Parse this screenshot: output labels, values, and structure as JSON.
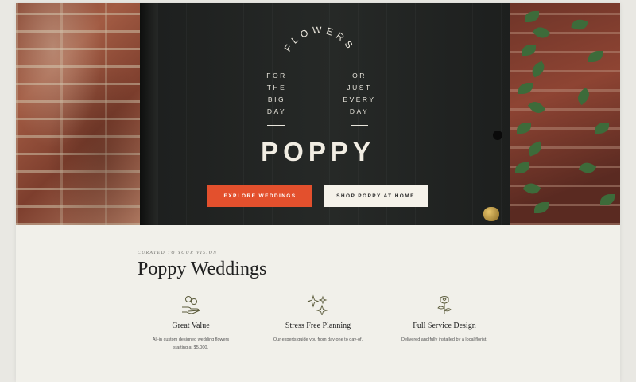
{
  "hero": {
    "arch_text": "FLOWERS",
    "tagline_left": [
      "FOR",
      "THE",
      "BIG",
      "DAY"
    ],
    "tagline_right": [
      "OR",
      "JUST",
      "EVERY",
      "DAY"
    ],
    "logo": "POPPY",
    "buttons": {
      "primary": "EXPLORE WEDDINGS",
      "secondary": "SHOP POPPY AT HOME"
    }
  },
  "weddings": {
    "eyebrow": "CURATED TO YOUR VISION",
    "title": "Poppy Weddings",
    "features": [
      {
        "icon": "hand-money-icon",
        "title": "Great Value",
        "desc": "All-in custom designed wedding flowers starting at $5,000."
      },
      {
        "icon": "sparkles-icon",
        "title": "Stress Free Planning",
        "desc": "Our experts guide you from day one to day-of."
      },
      {
        "icon": "rose-icon",
        "title": "Full Service Design",
        "desc": "Delivered and fully installed by a local florist."
      }
    ]
  },
  "colors": {
    "accent": "#e3502d",
    "door": "#1f2120",
    "background": "#f1f0ea"
  }
}
